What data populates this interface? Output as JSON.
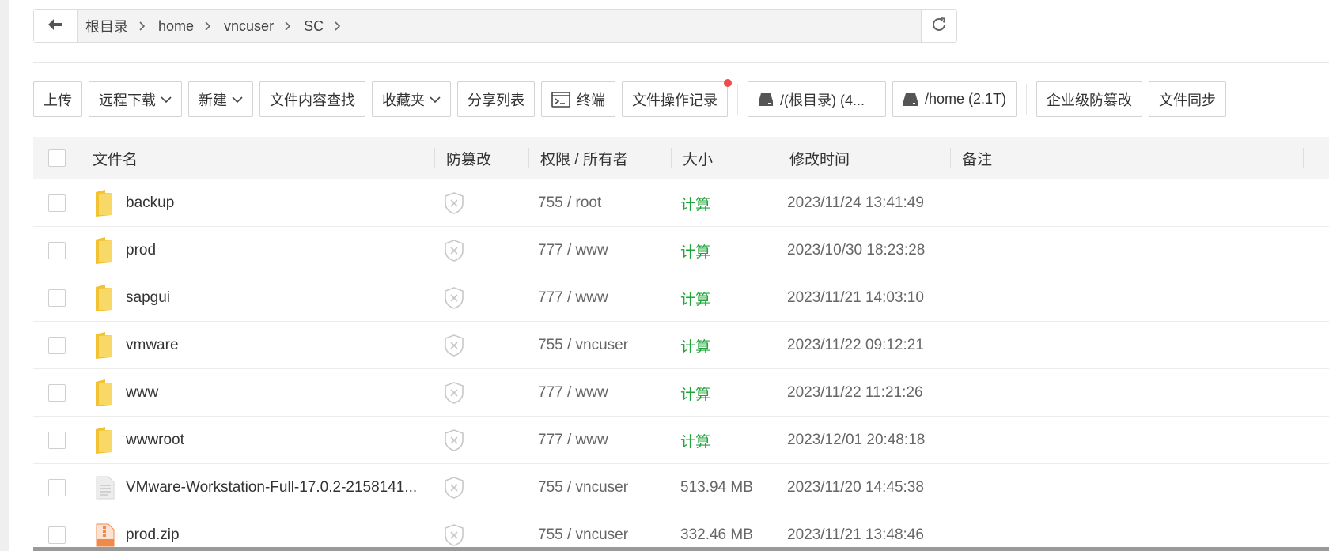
{
  "breadcrumb": {
    "items": [
      "根目录",
      "home",
      "vncuser",
      "SC"
    ]
  },
  "toolbar": {
    "upload": "上传",
    "remote_download": "远程下载",
    "new": "新建",
    "content_search": "文件内容查找",
    "favorites": "收藏夹",
    "share_list": "分享列表",
    "terminal": "终端",
    "operation_log": "文件操作记录",
    "disk_root": "/(根目录) (4...",
    "disk_home": "/home (2.1T)",
    "tamper_proof": "企业级防篡改",
    "file_sync": "文件同步"
  },
  "table": {
    "headers": {
      "name": "文件名",
      "tamper": "防篡改",
      "perm_owner": "权限 / 所有者",
      "size": "大小",
      "mtime": "修改时间",
      "remark": "备注"
    },
    "rows": [
      {
        "name": "backup",
        "type": "folder",
        "perm": "755 / root",
        "size": "计算",
        "mtime": "2023/11/24 13:41:49"
      },
      {
        "name": "prod",
        "type": "folder",
        "perm": "777 / www",
        "size": "计算",
        "mtime": "2023/10/30 18:23:28"
      },
      {
        "name": "sapgui",
        "type": "folder",
        "perm": "777 / www",
        "size": "计算",
        "mtime": "2023/11/21 14:03:10"
      },
      {
        "name": "vmware",
        "type": "folder",
        "perm": "755 / vncuser",
        "size": "计算",
        "mtime": "2023/11/22 09:12:21"
      },
      {
        "name": "www",
        "type": "folder",
        "perm": "777 / www",
        "size": "计算",
        "mtime": "2023/11/22 11:21:26"
      },
      {
        "name": "wwwroot",
        "type": "folder",
        "perm": "777 / www",
        "size": "计算",
        "mtime": "2023/12/01 20:48:18"
      },
      {
        "name": "VMware-Workstation-Full-17.0.2-2158141...",
        "type": "file",
        "perm": "755 / vncuser",
        "size": "513.94 MB",
        "mtime": "2023/11/20 14:45:38"
      },
      {
        "name": "prod.zip",
        "type": "zip",
        "perm": "755 / vncuser",
        "size": "332.46 MB",
        "mtime": "2023/11/21 13:48:46"
      }
    ]
  },
  "colors": {
    "accent_green": "#20a53a",
    "folder_yellow": "#f6cc4a",
    "notify_red": "#ef4b4b",
    "zip_orange": "#f08a4b"
  },
  "icons": {
    "back": "arrow-left-icon",
    "refresh": "refresh-icon",
    "terminal": "terminal-icon",
    "disk": "disk-icon",
    "folder": "folder-icon",
    "file": "file-icon",
    "zip": "zip-icon",
    "shield": "shield-x-icon"
  }
}
